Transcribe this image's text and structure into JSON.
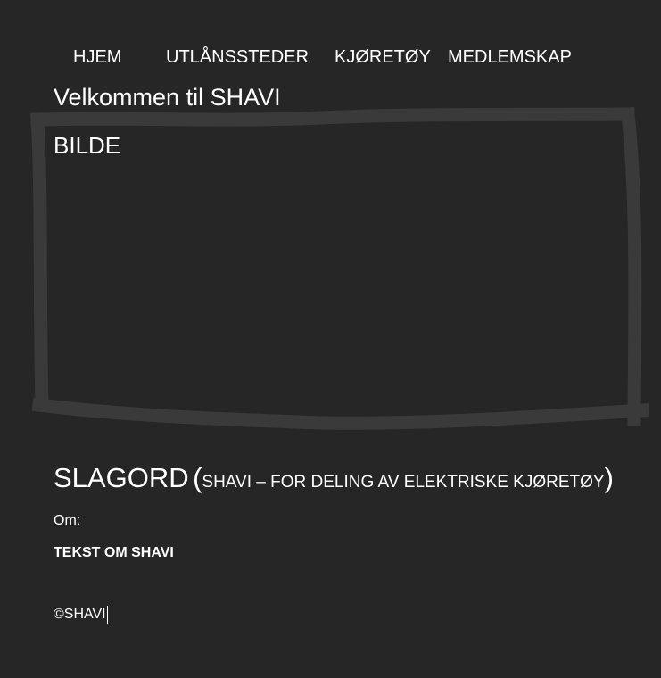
{
  "nav": {
    "items": [
      {
        "label": "HJEM"
      },
      {
        "label": "UTLÅNSSTEDER"
      },
      {
        "label": "KJØRETØY"
      },
      {
        "label": "MEDLEMSKAP"
      }
    ]
  },
  "hero": {
    "welcome": "Velkommen til SHAVI",
    "image_placeholder": "BILDE"
  },
  "slogan": {
    "main": "SLAGORD",
    "open_paren": "(",
    "sub": "SHAVI – FOR DELING AV ELEKTRISKE KJØRETØY",
    "close_paren": ")"
  },
  "about": {
    "label": "Om:",
    "text": "TEKST OM SHAVI"
  },
  "footer": {
    "copyright": "©SHAVI"
  },
  "colors": {
    "background": "#262626",
    "text": "#ffffff",
    "frame_stroke": "#3a3a3a"
  }
}
